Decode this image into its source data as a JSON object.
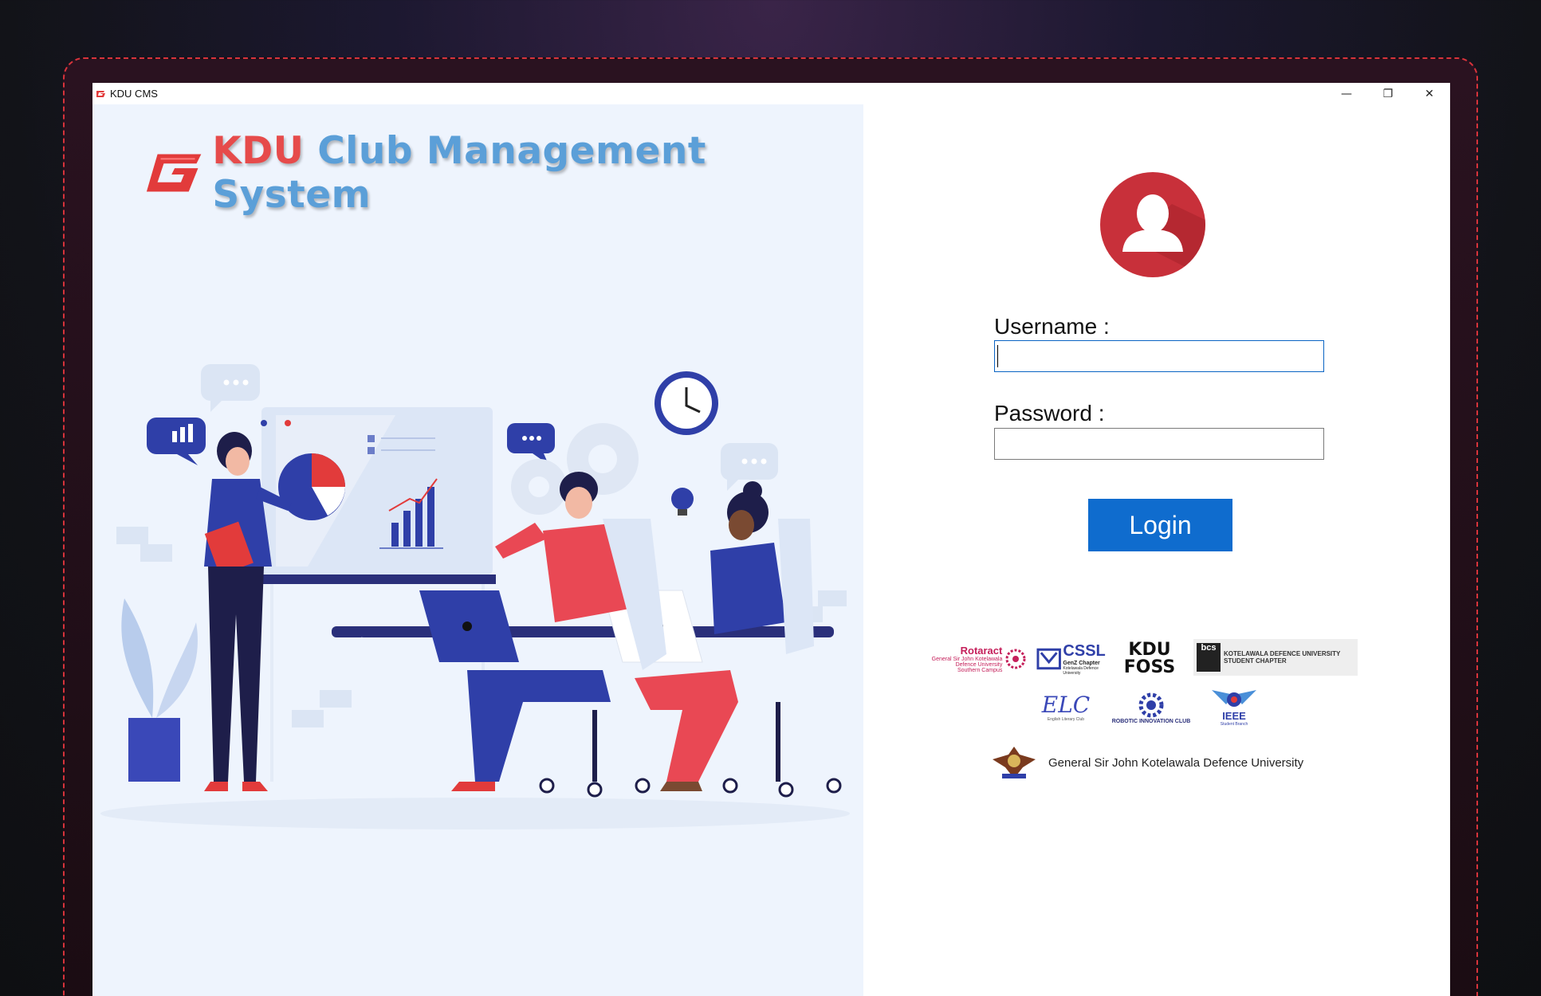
{
  "window": {
    "title": "KDU CMS",
    "controls": {
      "minimize": "—",
      "restore": "❐",
      "close": "✕"
    }
  },
  "brand": {
    "title_kdu": "KDU",
    "title_rest": "Club Management System",
    "logo_icon": "kdu-g-logo-icon"
  },
  "login": {
    "username_label": "Username :",
    "username_value": "",
    "password_label": "Password :",
    "password_value": "",
    "button_label": "Login"
  },
  "clubs": {
    "rotaract": {
      "title": "Rotaract",
      "sub1": "General Sir John Kotelawala",
      "sub2": "Defence University",
      "sub3": "Southern Campus"
    },
    "cssl": {
      "title": "CSSL",
      "sub1": "GenZ Chapter",
      "sub2": "Kotelawala Defence University"
    },
    "foss": {
      "line1": "KDU",
      "line2": "FOSS"
    },
    "bcs": {
      "badge": "bcs",
      "line1": "KOTELAWALA DEFENCE UNIVERSITY",
      "line2": "STUDENT CHAPTER"
    },
    "elc": {
      "title": "ELC",
      "sub": "English Literary Club"
    },
    "robotic": {
      "title": "ROBOTIC INNOVATION CLUB"
    },
    "ieee": {
      "title": "IEEE",
      "sub": "Student Branch"
    }
  },
  "university": {
    "name": "General Sir John Kotelawala Defence University"
  },
  "colors": {
    "accent": "#0f6cce",
    "brand_red": "#e64b4b",
    "brand_blue": "#5b9fd8",
    "avatar": "#c8303a"
  }
}
